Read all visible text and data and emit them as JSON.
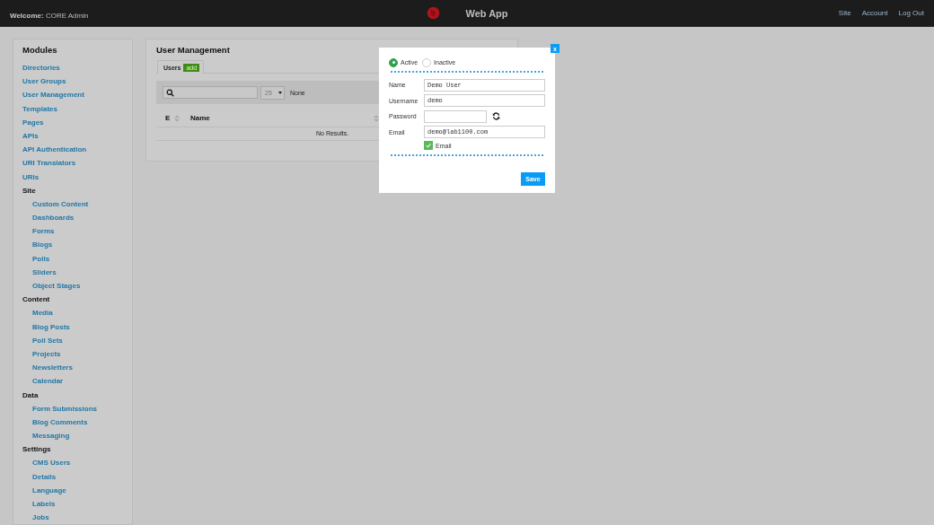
{
  "header": {
    "welcome_label": "Welcome:",
    "user": "CORE Admin",
    "title": "Web App",
    "links": [
      "Site",
      "Account",
      "Log Out"
    ]
  },
  "sidebar": {
    "title": "Modules",
    "items": [
      {
        "label": "Directories",
        "kind": "link"
      },
      {
        "label": "User Groups",
        "kind": "link"
      },
      {
        "label": "User Management",
        "kind": "link"
      },
      {
        "label": "Templates",
        "kind": "link"
      },
      {
        "label": "Pages",
        "kind": "link"
      },
      {
        "label": "APIs",
        "kind": "link"
      },
      {
        "label": "API Authentication",
        "kind": "link"
      },
      {
        "label": "URI Translators",
        "kind": "link"
      },
      {
        "label": "URIs",
        "kind": "link"
      },
      {
        "label": "Site",
        "kind": "heading",
        "children": [
          {
            "label": "Custom Content",
            "kind": "link"
          },
          {
            "label": "Dashboards",
            "kind": "link"
          },
          {
            "label": "Forms",
            "kind": "link"
          },
          {
            "label": "Blogs",
            "kind": "link"
          },
          {
            "label": "Polls",
            "kind": "link"
          },
          {
            "label": "Sliders",
            "kind": "link"
          },
          {
            "label": "Object Stages",
            "kind": "link"
          }
        ]
      },
      {
        "label": "Content",
        "kind": "heading",
        "children": [
          {
            "label": "Media",
            "kind": "link"
          },
          {
            "label": "Blog Posts",
            "kind": "link"
          },
          {
            "label": "Poll Sets",
            "kind": "link"
          },
          {
            "label": "Projects",
            "kind": "link"
          },
          {
            "label": "Newsletters",
            "kind": "link"
          },
          {
            "label": "Calendar",
            "kind": "link"
          }
        ]
      },
      {
        "label": "Data",
        "kind": "heading",
        "children": [
          {
            "label": "Form Submissions",
            "kind": "link"
          },
          {
            "label": "Blog Comments",
            "kind": "link"
          },
          {
            "label": "Messaging",
            "kind": "link"
          }
        ]
      },
      {
        "label": "Settings",
        "kind": "heading",
        "children": [
          {
            "label": "CMS Users",
            "kind": "link"
          },
          {
            "label": "Details",
            "kind": "link"
          },
          {
            "label": "Language",
            "kind": "link"
          },
          {
            "label": "Labels",
            "kind": "link"
          },
          {
            "label": "Jobs",
            "kind": "link"
          }
        ]
      }
    ]
  },
  "main": {
    "title": "User Management",
    "tabs": [
      {
        "label": "Users",
        "badge": "add",
        "selected": true
      }
    ],
    "filter": {
      "page_size": "25",
      "filter_label": "None"
    },
    "table": {
      "columns": [
        {
          "label": "E",
          "sortable": true
        },
        {
          "label": "Name",
          "sortable": true
        }
      ],
      "empty_message": "No Results."
    }
  },
  "modal": {
    "close": "x",
    "status": [
      {
        "label": "Active",
        "selected": true
      },
      {
        "label": "Inactive",
        "selected": false
      }
    ],
    "fields": [
      {
        "label": "Name",
        "value": "Demo User",
        "kind": "text"
      },
      {
        "label": "Username",
        "value": "demo",
        "kind": "text"
      },
      {
        "label": "Password",
        "kind": "password"
      },
      {
        "label": "Email",
        "value": "demo@lab1100.com",
        "kind": "text"
      }
    ],
    "checkbox": {
      "label": "Email",
      "checked": true
    },
    "save": "Save"
  }
}
